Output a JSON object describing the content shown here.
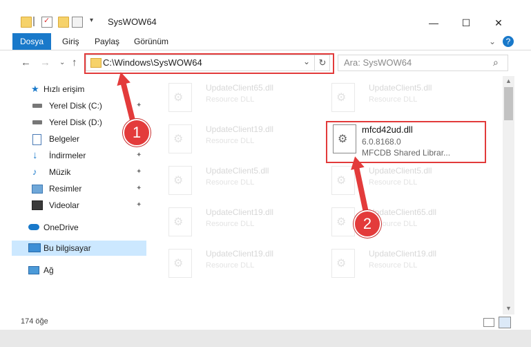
{
  "window": {
    "title": "SysWOW64",
    "minimize_glyph": "—",
    "maximize_glyph": "☐",
    "close_glyph": "✕"
  },
  "ribbon": {
    "tabs": [
      "Dosya",
      "Giriş",
      "Paylaş",
      "Görünüm"
    ],
    "help_glyph": "?",
    "expand_glyph": "⌄"
  },
  "address": {
    "path": "C:\\Windows\\SysWOW64",
    "search_placeholder": "Ara: SysWOW64",
    "back_glyph": "←",
    "forward_glyph": "→",
    "recent_glyph": "⌄",
    "up_glyph": "↑",
    "refresh_glyph": "↻",
    "dropdown_glyph": "⌄",
    "search_glyph": "⌕"
  },
  "sidebar": {
    "items": [
      {
        "label": "Hızlı erişim",
        "icon": "star-icon"
      },
      {
        "label": "Yerel Disk (C:)",
        "icon": "drive-icon",
        "pinned": true
      },
      {
        "label": "Yerel Disk (D:)",
        "icon": "drive-icon",
        "pinned": true
      },
      {
        "label": "Belgeler",
        "icon": "documents-icon",
        "pinned": true
      },
      {
        "label": "İndirmeler",
        "icon": "download-icon",
        "pinned": true
      },
      {
        "label": "Müzik",
        "icon": "music-icon",
        "pinned": true
      },
      {
        "label": "Resimler",
        "icon": "pictures-icon",
        "pinned": true
      },
      {
        "label": "Videolar",
        "icon": "videos-icon",
        "pinned": true
      },
      {
        "label": "OneDrive",
        "icon": "cloud-icon"
      },
      {
        "label": "Bu bilgisayar",
        "icon": "computer-icon",
        "selected": true
      },
      {
        "label": "Ağ",
        "icon": "network-icon"
      }
    ],
    "pin_glyph": "📌"
  },
  "files": [
    {
      "name": "UpdateClient65.dll",
      "desc": "Resource DLL"
    },
    {
      "name": "UpdateClient5.dll",
      "desc": "Resource DLL"
    },
    {
      "name": "UpdateClient19.dll",
      "desc": "Resource DLL"
    },
    {
      "name": "mfcd42ud.dll",
      "version": "6.0.8168.0",
      "desc": "MFCDB Shared Librar..."
    },
    {
      "name": "UpdateClient5.dll",
      "desc": "Resource DLL"
    },
    {
      "name": "UpdateClient5.dll",
      "desc": "Resource DLL"
    },
    {
      "name": "UpdateClient19.dll",
      "desc": "Resource DLL"
    },
    {
      "name": "UpdateClient65.dll",
      "desc": "Resource DLL"
    },
    {
      "name": "UpdateClient19.dll",
      "desc": "Resource DLL"
    },
    {
      "name": "UpdateClient19.dll",
      "desc": "Resource DLL"
    }
  ],
  "status": {
    "item_count": "174 öğe"
  },
  "annotations": {
    "step1": "1",
    "step2": "2",
    "color": "#e33b3b"
  }
}
